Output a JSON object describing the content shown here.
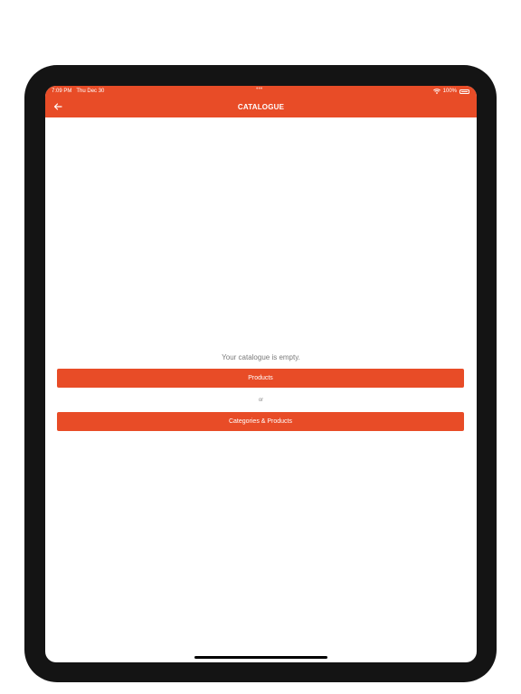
{
  "status_bar": {
    "time": "7:09 PM",
    "date": "Thu Dec 30",
    "battery": "100%"
  },
  "header": {
    "title": "CATALOGUE",
    "back_icon": "arrow-left-icon"
  },
  "main": {
    "empty_message": "Your catalogue is empty.",
    "products_button": "Products",
    "or_label": "or",
    "categories_button": "Categories & Products"
  },
  "colors": {
    "accent": "#e84c27",
    "device_frame": "#141414",
    "background": "#ffffff"
  }
}
